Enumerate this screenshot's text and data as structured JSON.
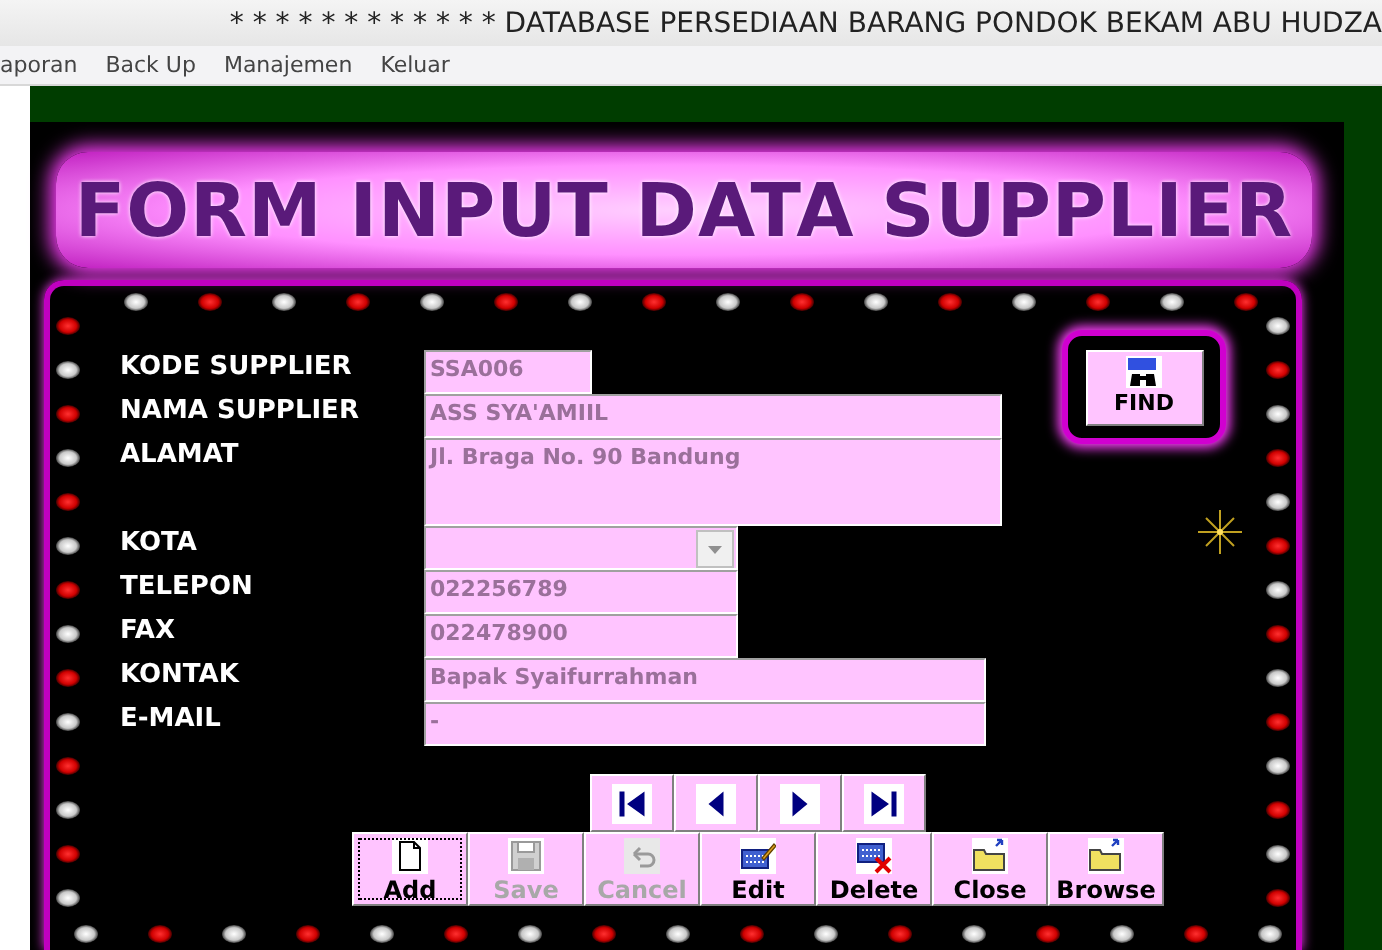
{
  "window": {
    "title": "* * * * * * * * * * * *  DATABASE  PERSEDIAAN BARANG PONDOK BEKAM ABU HUDZA"
  },
  "menu": [
    "aporan",
    "Back Up",
    "Manajemen",
    "Keluar"
  ],
  "banner": {
    "title": "FORM INPUT DATA SUPPLIER"
  },
  "fields": [
    {
      "label": "KODE SUPPLIER",
      "kind": "text",
      "value": "SSA006"
    },
    {
      "label": "NAMA SUPPLIER",
      "kind": "text",
      "value": "ASS SYA'AMIIL"
    },
    {
      "label": "ALAMAT",
      "kind": "textarea",
      "value": "Jl. Braga No. 90 Bandung"
    },
    {
      "label": "KOTA",
      "kind": "combo"
    },
    {
      "label": "TELEPON",
      "kind": "text",
      "value": "022256789"
    },
    {
      "label": "FAX",
      "kind": "text",
      "value": "022478900"
    },
    {
      "label": "KONTAK",
      "kind": "text",
      "value": "Bapak Syaifurrahman"
    },
    {
      "label": "E-MAIL",
      "kind": "text",
      "value": "-"
    }
  ],
  "find_button": {
    "label": "FIND"
  },
  "buttons": [
    {
      "kind": "add",
      "label": "Add",
      "disabled": false,
      "focused": true
    },
    {
      "kind": "save",
      "label": "Save",
      "disabled": true,
      "focused": false
    },
    {
      "kind": "cancel",
      "label": "Cancel",
      "disabled": true,
      "focused": false
    },
    {
      "kind": "edit",
      "label": "Edit",
      "disabled": false,
      "focused": false
    },
    {
      "kind": "delete",
      "label": "Delete",
      "disabled": false,
      "focused": false
    },
    {
      "kind": "close",
      "label": "Close",
      "disabled": false,
      "focused": false
    },
    {
      "kind": "browse",
      "label": "Browse",
      "disabled": false,
      "focused": false
    }
  ]
}
